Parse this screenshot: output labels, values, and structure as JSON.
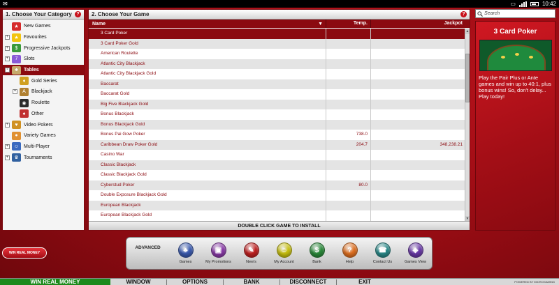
{
  "status_bar": {
    "time": "10:42"
  },
  "categories": {
    "title": "1. Choose Your Category",
    "items": [
      {
        "label": "New Games",
        "icon": "new-games-icon",
        "toggle": "",
        "color": "#d62a2a",
        "glyph": "★",
        "selected": false,
        "sub": false
      },
      {
        "label": "Favourites",
        "icon": "star-icon",
        "toggle": "+",
        "color": "#f2c40f",
        "glyph": "★",
        "selected": false,
        "sub": false
      },
      {
        "label": "Progressive Jackpots",
        "icon": "jackpot-icon",
        "toggle": "+",
        "color": "#3a9a3a",
        "glyph": "$",
        "selected": false,
        "sub": false
      },
      {
        "label": "Slots",
        "icon": "slots-icon",
        "toggle": "+",
        "color": "#8a5ad6",
        "glyph": "7",
        "selected": false,
        "sub": false
      },
      {
        "label": "Tables",
        "icon": "tables-icon",
        "toggle": "-",
        "color": "#c6a96a",
        "glyph": "♣",
        "selected": true,
        "sub": false
      },
      {
        "label": "Gold Series",
        "icon": "gold-series-icon",
        "toggle": "",
        "color": "#d0a020",
        "glyph": "♦",
        "selected": false,
        "sub": true
      },
      {
        "label": "Blackjack",
        "icon": "blackjack-icon",
        "toggle": "+",
        "color": "#b08030",
        "glyph": "A",
        "selected": false,
        "sub": true
      },
      {
        "label": "Roulette",
        "icon": "roulette-icon",
        "toggle": "",
        "color": "#2a2a2a",
        "glyph": "◉",
        "selected": false,
        "sub": true
      },
      {
        "label": "Other",
        "icon": "other-games-icon",
        "toggle": "",
        "color": "#c03030",
        "glyph": "♠",
        "selected": false,
        "sub": true
      },
      {
        "label": "Video Pokers",
        "icon": "video-poker-icon",
        "toggle": "+",
        "color": "#d09020",
        "glyph": "♥",
        "selected": false,
        "sub": false
      },
      {
        "label": "Variety Games",
        "icon": "variety-games-icon",
        "toggle": "",
        "color": "#e09030",
        "glyph": "●",
        "selected": false,
        "sub": false
      },
      {
        "label": "Multi-Player",
        "icon": "multi-player-icon",
        "toggle": "+",
        "color": "#3a6ac0",
        "glyph": "☺",
        "selected": false,
        "sub": false
      },
      {
        "label": "Tournaments",
        "icon": "tournaments-icon",
        "toggle": "+",
        "color": "#3060a0",
        "glyph": "♛",
        "selected": false,
        "sub": false
      }
    ]
  },
  "games": {
    "title": "2. Choose Your Game",
    "columns": {
      "name": "Name",
      "temp": "Temp.",
      "jackpot": "Jackpot"
    },
    "rows": [
      {
        "name": "3 Card Poker",
        "temp": "",
        "jackpot": "",
        "selected": true
      },
      {
        "name": "3 Card Poker Gold",
        "temp": "",
        "jackpot": ""
      },
      {
        "name": "American Roulette",
        "temp": "",
        "jackpot": ""
      },
      {
        "name": "Atlantic City Blackjack",
        "temp": "",
        "jackpot": ""
      },
      {
        "name": "Atlantic City Blackjack Gold",
        "temp": "",
        "jackpot": ""
      },
      {
        "name": "Baccarat",
        "temp": "",
        "jackpot": ""
      },
      {
        "name": "Baccarat Gold",
        "temp": "",
        "jackpot": ""
      },
      {
        "name": "Big Five Blackjack Gold",
        "temp": "",
        "jackpot": ""
      },
      {
        "name": "Bonus Blackjack",
        "temp": "",
        "jackpot": ""
      },
      {
        "name": "Bonus Blackjack Gold",
        "temp": "",
        "jackpot": ""
      },
      {
        "name": "Bonus Pai Gow Poker",
        "temp": "738.0",
        "jackpot": ""
      },
      {
        "name": "Caribbean Draw Poker Gold",
        "temp": "204.7",
        "jackpot": "348,238.21"
      },
      {
        "name": "Casino War",
        "temp": "",
        "jackpot": ""
      },
      {
        "name": "Classic Blackjack",
        "temp": "",
        "jackpot": ""
      },
      {
        "name": "Classic Blackjack Gold",
        "temp": "",
        "jackpot": ""
      },
      {
        "name": "Cyberstud Poker",
        "temp": "80.0",
        "jackpot": ""
      },
      {
        "name": "Double Exposure Blackjack Gold",
        "temp": "",
        "jackpot": ""
      },
      {
        "name": "European Blackjack",
        "temp": "",
        "jackpot": ""
      },
      {
        "name": "European Blackjack Gold",
        "temp": "",
        "jackpot": ""
      }
    ],
    "install_label": "DOUBLE CLICK GAME TO INSTALL"
  },
  "search": {
    "placeholder": "Search"
  },
  "promo": {
    "title": "3 Card Poker",
    "text": "Play the Pair Plus or Ante games and win up to 40:1, plus bonus wins! So, don't delay... Play today!"
  },
  "win_button": {
    "label": "WIN REAL MONEY"
  },
  "dock": {
    "advanced_label": "ADVANCED",
    "buttons": [
      {
        "label": "Games",
        "icon": "games-icon",
        "color": "#3b5bb0",
        "glyph": "♣"
      },
      {
        "label": "My Promotions",
        "icon": "promotions-icon",
        "color": "#8a3aa8",
        "glyph": "▣"
      },
      {
        "label": "New's",
        "icon": "news-icon",
        "color": "#c02020",
        "glyph": "✎"
      },
      {
        "label": "My Account",
        "icon": "account-icon",
        "color": "#c8c010",
        "glyph": "☺"
      },
      {
        "label": "Bank",
        "icon": "bank-icon",
        "color": "#2a8a3a",
        "glyph": "$"
      },
      {
        "label": "Help",
        "icon": "help-icon",
        "color": "#e07020",
        "glyph": "?"
      },
      {
        "label": "Contact Us",
        "icon": "contact-icon",
        "color": "#2a8a8a",
        "glyph": "☎"
      },
      {
        "label": "Games View",
        "icon": "games-view-icon",
        "color": "#6a3aa8",
        "glyph": "◈"
      }
    ]
  },
  "menubar": {
    "win": "WIN REAL MONEY",
    "items": [
      "WINDOW",
      "OPTIONS",
      "BANK",
      "DISCONNECT",
      "EXIT"
    ],
    "powered": "POWERED BY MICROGAMING"
  }
}
